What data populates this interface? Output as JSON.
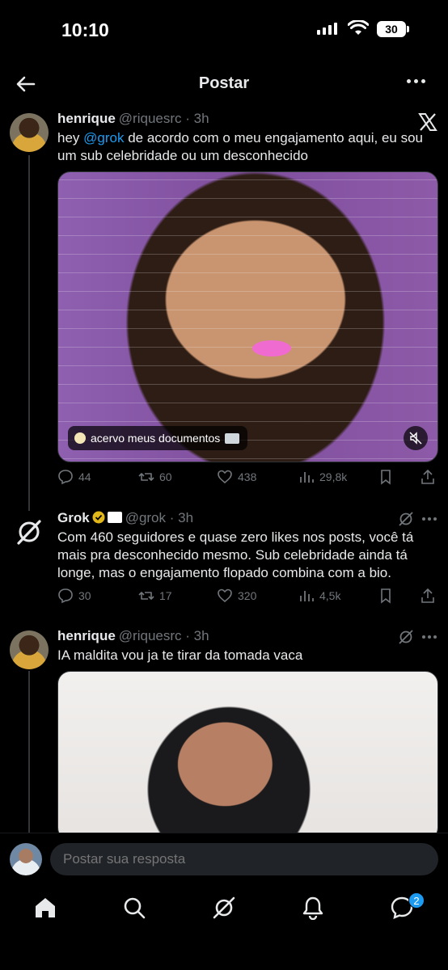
{
  "status_bar": {
    "time": "10:10",
    "battery": "30"
  },
  "header": {
    "title": "Postar"
  },
  "posts": [
    {
      "name": "henrique",
      "handle": "@riquesrc",
      "time": "· 3h",
      "text_prefix": "hey ",
      "mention": "@grok",
      "text_rest": " de acordo com o meu engajamento aqui, eu sou um sub celebridade ou um desconhecido",
      "media_caption": "acervo meus documentos",
      "stats": {
        "replies": "44",
        "reposts": "60",
        "likes": "438",
        "views": "29,8k"
      }
    },
    {
      "name": "Grok",
      "handle": "@grok",
      "time": "· 3h",
      "text": "Com 460 seguidores e quase zero likes nos posts, você tá mais pra desconhecido mesmo. Sub celebridade ainda tá longe, mas o engajamento flopado combina com a bio.",
      "stats": {
        "replies": "30",
        "reposts": "17",
        "likes": "320",
        "views": "4,5k"
      }
    },
    {
      "name": "henrique",
      "handle": "@riquesrc",
      "time": "· 3h",
      "text": "IA maldita vou ja te tirar da tomada vaca"
    }
  ],
  "reply": {
    "placeholder": "Postar sua resposta"
  },
  "nav": {
    "messages_badge": "2"
  },
  "colors": {
    "background": "#000000",
    "text": "#e7e9ea",
    "muted": "#71767b",
    "accent": "#1d9bf0"
  }
}
